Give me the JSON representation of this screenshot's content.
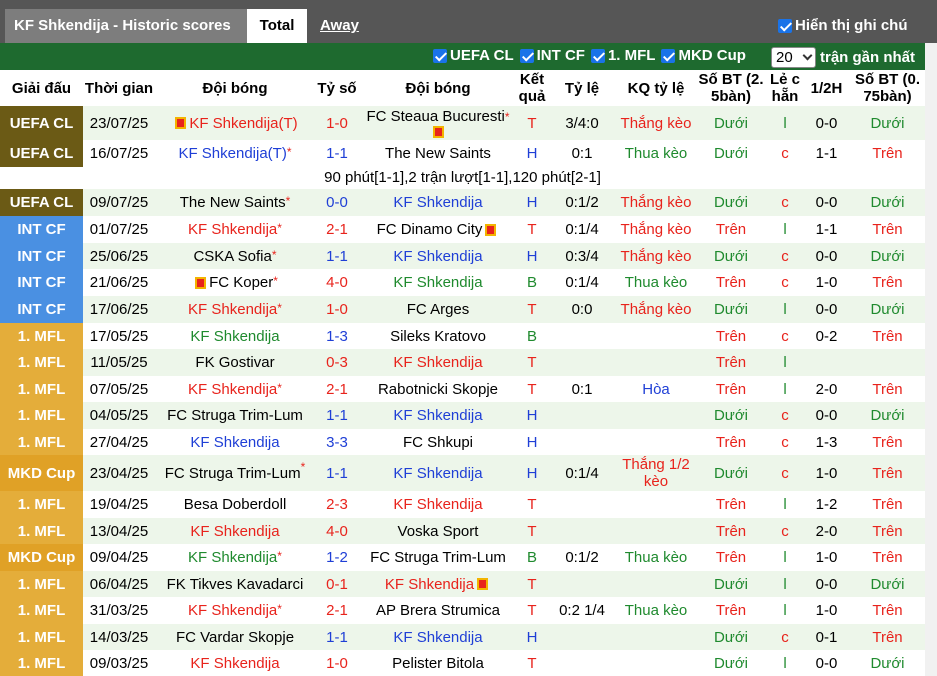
{
  "header": {
    "title": "KF Shkendija - Historic scores",
    "tab_total": "Total",
    "tab_away": "Away",
    "show_toggle": "Hiển thị ghi chú"
  },
  "filters": {
    "items": [
      "UEFA CL",
      "INT CF",
      "1. MFL",
      "MKD Cup"
    ],
    "count": "20",
    "recent_label": "trận gần nhất"
  },
  "columns": {
    "league": "Giải đấu",
    "time": "Thời gian",
    "home": "Đội bóng",
    "score": "Tỷ số",
    "away": "Đội bóng",
    "result": "Kết quả",
    "ratio": "Tỷ lệ",
    "kq_ratio": "KQ tỷ lệ",
    "goals25": "Số BT (2. 5bàn)",
    "odd_even": "Lẻ c hẵn",
    "half": "1/2H",
    "goals075": "Số BT (0. 75bàn)"
  },
  "note": "90 phút[1-1],2 trận lượt[1-1],120 phút[2-1]",
  "rows": [
    {
      "league": "UEFA CL",
      "lg": "ucl",
      "date": "23/07/25",
      "home": "KF Shkendija(T)",
      "home_c": "red",
      "home_flag": true,
      "home_star": false,
      "score": "1-0",
      "score_c": "red",
      "away": "FC Steaua Bucuresti",
      "away_c": "",
      "away_star": true,
      "away_flag_below": true,
      "res": "T",
      "res_c": "red",
      "ratio": "3/4:0",
      "kq": "Thắng kèo",
      "kq_c": "red",
      "g25": "Dưới",
      "g25_c": "grn",
      "oe": "l",
      "oe_c": "grn",
      "half": "0-0",
      "g075": "Dưới",
      "g075_c": "grn",
      "bg": "alt",
      "h": 34
    },
    {
      "league": "UEFA CL",
      "lg": "ucl",
      "date": "16/07/25",
      "home": "KF Shkendija(T)",
      "home_c": "blue",
      "home_star": true,
      "score": "1-1",
      "score_c": "blue",
      "away": "The New Saints",
      "away_c": "",
      "res": "H",
      "res_c": "blue",
      "ratio": "0:1",
      "kq": "Thua kèo",
      "kq_c": "grn",
      "g25": "Dưới",
      "g25_c": "grn",
      "oe": "c",
      "oe_c": "red",
      "half": "1-1",
      "g075": "Trên",
      "g075_c": "red",
      "bg": "wht",
      "h": 27
    },
    {
      "note": true
    },
    {
      "league": "UEFA CL",
      "lg": "ucl",
      "date": "09/07/25",
      "home": "The New Saints",
      "home_c": "",
      "home_star": true,
      "score": "0-0",
      "score_c": "blue",
      "away": "KF Shkendija",
      "away_c": "blue",
      "res": "H",
      "res_c": "blue",
      "ratio": "0:1/2",
      "kq": "Thắng kèo",
      "kq_c": "red",
      "g25": "Dưới",
      "g25_c": "grn",
      "oe": "c",
      "oe_c": "red",
      "half": "0-0",
      "g075": "Dưới",
      "g075_c": "grn",
      "bg": "alt",
      "h": 27
    },
    {
      "league": "INT CF",
      "lg": "int",
      "date": "01/07/25",
      "home": "KF Shkendija",
      "home_c": "red",
      "home_star": true,
      "score": "2-1",
      "score_c": "red",
      "away": "FC Dinamo City",
      "away_c": "",
      "away_flag": true,
      "res": "T",
      "res_c": "red",
      "ratio": "0:1/4",
      "kq": "Thắng kèo",
      "kq_c": "red",
      "g25": "Trên",
      "g25_c": "red",
      "oe": "l",
      "oe_c": "grn",
      "half": "1-1",
      "g075": "Trên",
      "g075_c": "red",
      "bg": "wht",
      "h": 27
    },
    {
      "league": "INT CF",
      "lg": "int",
      "date": "25/06/25",
      "home": "CSKA Sofia",
      "home_c": "",
      "home_star": true,
      "score": "1-1",
      "score_c": "blue",
      "away": "KF Shkendija",
      "away_c": "blue",
      "res": "H",
      "res_c": "blue",
      "ratio": "0:3/4",
      "kq": "Thắng kèo",
      "kq_c": "red",
      "g25": "Dưới",
      "g25_c": "grn",
      "oe": "c",
      "oe_c": "red",
      "half": "0-0",
      "g075": "Dưới",
      "g075_c": "grn",
      "bg": "alt",
      "h": 26
    },
    {
      "league": "INT CF",
      "lg": "int",
      "date": "21/06/25",
      "home": "FC Koper",
      "home_c": "",
      "home_flag": true,
      "home_star": true,
      "score": "4-0",
      "score_c": "red",
      "away": "KF Shkendija",
      "away_c": "grn",
      "res": "B",
      "res_c": "grn",
      "ratio": "0:1/4",
      "kq": "Thua kèo",
      "kq_c": "grn",
      "g25": "Trên",
      "g25_c": "red",
      "oe": "c",
      "oe_c": "red",
      "half": "1-0",
      "g075": "Trên",
      "g075_c": "red",
      "bg": "wht",
      "h": 27
    },
    {
      "league": "INT CF",
      "lg": "int",
      "date": "17/06/25",
      "home": "KF Shkendija",
      "home_c": "red",
      "home_star": true,
      "score": "1-0",
      "score_c": "red",
      "away": "FC Arges",
      "away_c": "",
      "res": "T",
      "res_c": "red",
      "ratio": "0:0",
      "kq": "Thắng kèo",
      "kq_c": "red",
      "g25": "Dưới",
      "g25_c": "grn",
      "oe": "l",
      "oe_c": "grn",
      "half": "0-0",
      "g075": "Dưới",
      "g075_c": "grn",
      "bg": "alt",
      "h": 27
    },
    {
      "league": "1. MFL",
      "lg": "mfl",
      "date": "17/05/25",
      "home": "KF Shkendija",
      "home_c": "grn",
      "score": "1-3",
      "score_c": "blue",
      "away": "Sileks Kratovo",
      "away_c": "",
      "res": "B",
      "res_c": "grn",
      "ratio": "",
      "kq": "",
      "kq_c": "",
      "g25": "Trên",
      "g25_c": "red",
      "oe": "c",
      "oe_c": "red",
      "half": "0-2",
      "g075": "Trên",
      "g075_c": "red",
      "bg": "wht",
      "h": 26
    },
    {
      "league": "1. MFL",
      "lg": "mfl",
      "date": "11/05/25",
      "home": "FK Gostivar",
      "home_c": "",
      "score": "0-3",
      "score_c": "red",
      "away": "KF Shkendija",
      "away_c": "red",
      "res": "T",
      "res_c": "red",
      "ratio": "",
      "kq": "",
      "kq_c": "",
      "g25": "Trên",
      "g25_c": "red",
      "oe": "l",
      "oe_c": "grn",
      "half": "",
      "g075": "",
      "g075_c": "",
      "bg": "alt",
      "h": 27
    },
    {
      "league": "1. MFL",
      "lg": "mfl",
      "date": "07/05/25",
      "home": "KF Shkendija",
      "home_c": "red",
      "home_star": true,
      "score": "2-1",
      "score_c": "red",
      "away": "Rabotnicki Skopje",
      "away_c": "",
      "res": "T",
      "res_c": "red",
      "ratio": "0:1",
      "kq": "Hòa",
      "kq_c": "blue",
      "g25": "Trên",
      "g25_c": "red",
      "oe": "l",
      "oe_c": "grn",
      "half": "2-0",
      "g075": "Trên",
      "g075_c": "red",
      "bg": "wht",
      "h": 26
    },
    {
      "league": "1. MFL",
      "lg": "mfl",
      "date": "04/05/25",
      "home": "FC Struga Trim-Lum",
      "home_c": "",
      "score": "1-1",
      "score_c": "blue",
      "away": "KF Shkendija",
      "away_c": "blue",
      "res": "H",
      "res_c": "blue",
      "ratio": "",
      "kq": "",
      "kq_c": "",
      "g25": "Dưới",
      "g25_c": "grn",
      "oe": "c",
      "oe_c": "red",
      "half": "0-0",
      "g075": "Dưới",
      "g075_c": "grn",
      "bg": "alt",
      "h": 27
    },
    {
      "league": "1. MFL",
      "lg": "mfl",
      "date": "27/04/25",
      "home": "KF Shkendija",
      "home_c": "blue",
      "score": "3-3",
      "score_c": "blue",
      "away": "FC Shkupi",
      "away_c": "",
      "res": "H",
      "res_c": "blue",
      "ratio": "",
      "kq": "",
      "kq_c": "",
      "g25": "Trên",
      "g25_c": "red",
      "oe": "c",
      "oe_c": "red",
      "half": "1-3",
      "g075": "Trên",
      "g075_c": "red",
      "bg": "wht",
      "h": 26
    },
    {
      "league": "MKD Cup",
      "lg": "mkd",
      "date": "23/04/25",
      "home": "FC Struga Trim-Lum",
      "home_c": "",
      "home_star": true,
      "score": "1-1",
      "score_c": "blue",
      "away": "KF Shkendija",
      "away_c": "blue",
      "res": "H",
      "res_c": "blue",
      "ratio": "0:1/4",
      "kq": "Thắng 1/2\nkèo",
      "kq_c": "red",
      "g25": "Dưới",
      "g25_c": "grn",
      "oe": "c",
      "oe_c": "red",
      "half": "1-0",
      "g075": "Trên",
      "g075_c": "red",
      "bg": "alt",
      "h": 36
    },
    {
      "league": "1. MFL",
      "lg": "mfl",
      "date": "19/04/25",
      "home": "Besa Doberdoll",
      "home_c": "",
      "score": "2-3",
      "score_c": "red",
      "away": "KF Shkendija",
      "away_c": "red",
      "res": "T",
      "res_c": "red",
      "ratio": "",
      "kq": "",
      "kq_c": "",
      "g25": "Trên",
      "g25_c": "red",
      "oe": "l",
      "oe_c": "grn",
      "half": "1-2",
      "g075": "Trên",
      "g075_c": "red",
      "bg": "wht",
      "h": 27
    },
    {
      "league": "1. MFL",
      "lg": "mfl",
      "date": "13/04/25",
      "home": "KF Shkendija",
      "home_c": "red",
      "score": "4-0",
      "score_c": "red",
      "away": "Voska Sport",
      "away_c": "",
      "res": "T",
      "res_c": "red",
      "ratio": "",
      "kq": "",
      "kq_c": "",
      "g25": "Trên",
      "g25_c": "red",
      "oe": "c",
      "oe_c": "red",
      "half": "2-0",
      "g075": "Trên",
      "g075_c": "red",
      "bg": "alt",
      "h": 26
    },
    {
      "league": "MKD Cup",
      "lg": "mkd",
      "date": "09/04/25",
      "home": "KF Shkendija",
      "home_c": "grn",
      "home_star": true,
      "score": "1-2",
      "score_c": "blue",
      "away": "FC Struga Trim-Lum",
      "away_c": "",
      "res": "B",
      "res_c": "grn",
      "ratio": "0:1/2",
      "kq": "Thua kèo",
      "kq_c": "grn",
      "g25": "Trên",
      "g25_c": "red",
      "oe": "l",
      "oe_c": "grn",
      "half": "1-0",
      "g075": "Trên",
      "g075_c": "red",
      "bg": "wht",
      "h": 27
    },
    {
      "league": "1. MFL",
      "lg": "mfl",
      "date": "06/04/25",
      "home": "FK Tikves Kavadarci",
      "home_c": "",
      "score": "0-1",
      "score_c": "red",
      "away": "KF Shkendija",
      "away_c": "red",
      "away_flag": true,
      "res": "T",
      "res_c": "red",
      "ratio": "",
      "kq": "",
      "kq_c": "",
      "g25": "Dưới",
      "g25_c": "grn",
      "oe": "l",
      "oe_c": "grn",
      "half": "0-0",
      "g075": "Dưới",
      "g075_c": "grn",
      "bg": "alt",
      "h": 26
    },
    {
      "league": "1. MFL",
      "lg": "mfl",
      "date": "31/03/25",
      "home": "KF Shkendija",
      "home_c": "red",
      "home_star": true,
      "score": "2-1",
      "score_c": "red",
      "away": "AP Brera Strumica",
      "away_c": "",
      "res": "T",
      "res_c": "red",
      "ratio": "0:2 1/4",
      "kq": "Thua kèo",
      "kq_c": "grn",
      "g25": "Trên",
      "g25_c": "red",
      "oe": "l",
      "oe_c": "grn",
      "half": "1-0",
      "g075": "Trên",
      "g075_c": "red",
      "bg": "wht",
      "h": 27
    },
    {
      "league": "1. MFL",
      "lg": "mfl",
      "date": "14/03/25",
      "home": "FC Vardar Skopje",
      "home_c": "",
      "score": "1-1",
      "score_c": "blue",
      "away": "KF Shkendija",
      "away_c": "blue",
      "res": "H",
      "res_c": "blue",
      "ratio": "",
      "kq": "",
      "kq_c": "",
      "g25": "Dưới",
      "g25_c": "grn",
      "oe": "c",
      "oe_c": "red",
      "half": "0-1",
      "g075": "Trên",
      "g075_c": "red",
      "bg": "alt",
      "h": 26
    },
    {
      "league": "1. MFL",
      "lg": "mfl",
      "date": "09/03/25",
      "home": "KF Shkendija",
      "home_c": "red",
      "score": "1-0",
      "score_c": "red",
      "away": "Pelister Bitola",
      "away_c": "",
      "res": "T",
      "res_c": "red",
      "ratio": "",
      "kq": "",
      "kq_c": "",
      "g25": "Dưới",
      "g25_c": "grn",
      "oe": "l",
      "oe_c": "grn",
      "half": "0-0",
      "g075": "Dưới",
      "g075_c": "grn",
      "bg": "wht",
      "h": 27
    }
  ]
}
